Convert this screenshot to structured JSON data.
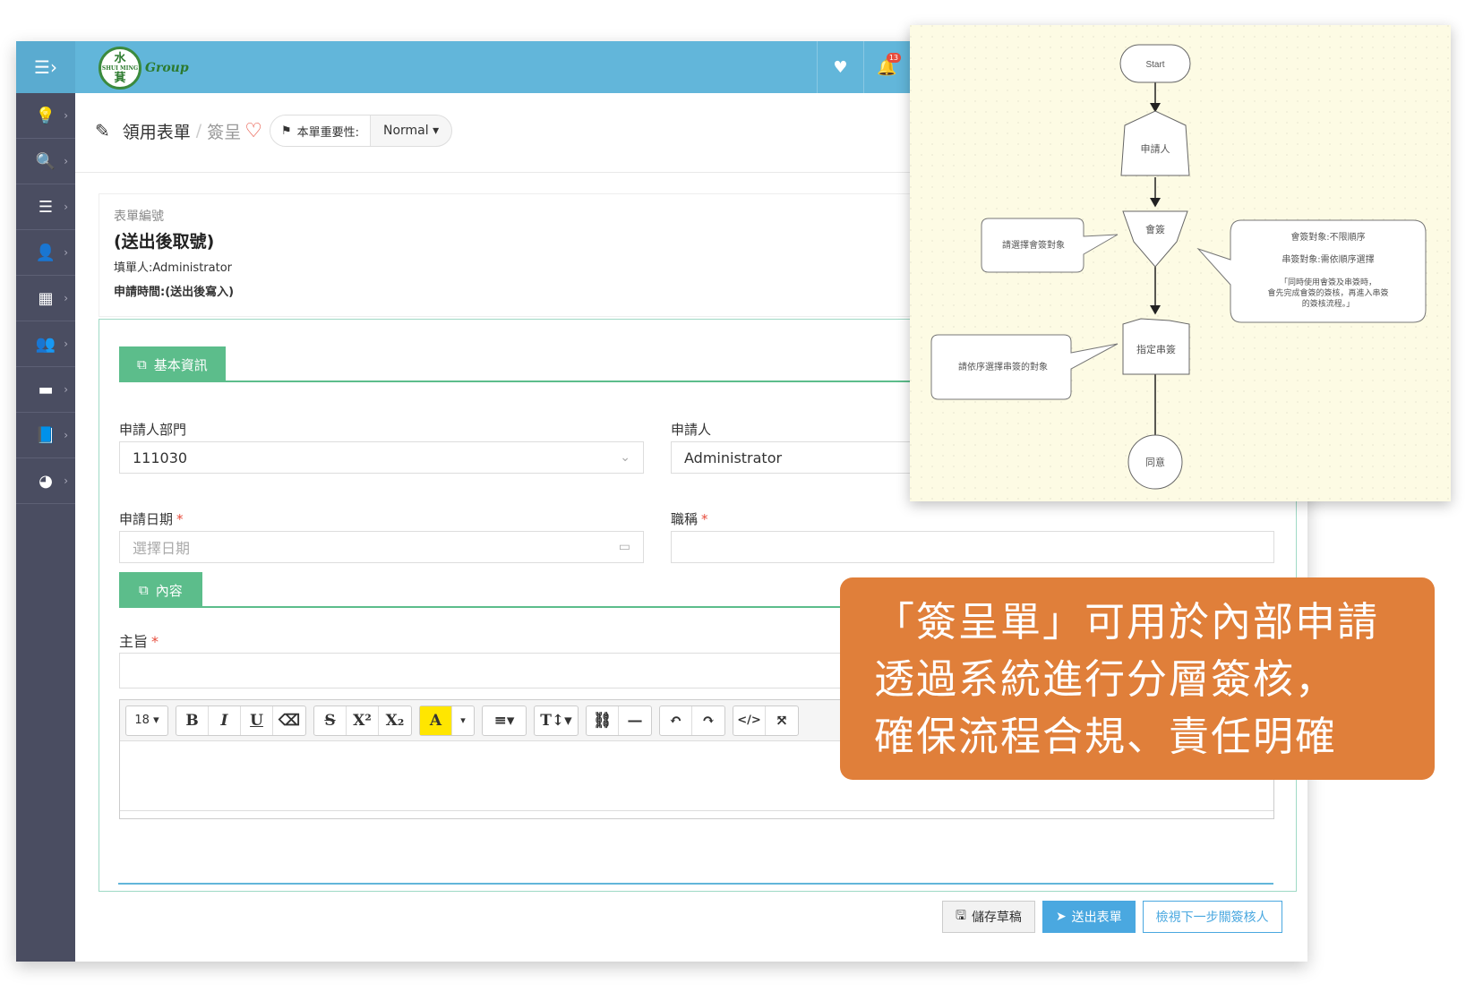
{
  "topbar": {
    "logo_char_top": "水",
    "logo_char_mid": "SHUI MING",
    "logo_char_bottom": "萁",
    "logo_text": "Group",
    "badge_count": "13"
  },
  "sidebar": {
    "items": [
      {
        "icon": "lightbulb-icon",
        "glyph": "💡"
      },
      {
        "icon": "search-icon",
        "glyph": "🔍"
      },
      {
        "icon": "server-icon",
        "glyph": "☰"
      },
      {
        "icon": "user-icon",
        "glyph": "👤"
      },
      {
        "icon": "building-icon",
        "glyph": "▦"
      },
      {
        "icon": "users-icon",
        "glyph": "👥"
      },
      {
        "icon": "archive-icon",
        "glyph": "▬"
      },
      {
        "icon": "book-icon",
        "glyph": "📘"
      },
      {
        "icon": "dashboard-icon",
        "glyph": "◕"
      }
    ]
  },
  "breadcrumb": {
    "form_type": "領用表單",
    "separator": "/",
    "current": "簽呈",
    "priority_label": "本單重要性:",
    "priority_value": "Normal"
  },
  "meta": {
    "form_no_label": "表單編號",
    "form_no_value": "(送出後取號)",
    "filler": "填單人:Administrator",
    "apply_time": "申請時間:(送出後寫入)"
  },
  "sections": {
    "basic": "基本資訊",
    "content": "內容"
  },
  "fields": {
    "dept_label": "申請人部門",
    "dept_value": "111030",
    "applicant_label": "申請人",
    "applicant_value": "Administrator",
    "date_label": "申請日期",
    "date_placeholder": "選擇日期",
    "title_label": "職稱",
    "subject_label": "主旨",
    "required_mark": "*"
  },
  "editor": {
    "font_size": "18"
  },
  "actions": {
    "save": "儲存草稿",
    "send": "送出表單",
    "next": "檢視下一步關簽核人"
  },
  "flow": {
    "start": "Start",
    "applicant": "申請人",
    "countersign": "會簽",
    "countersign_note": "請選擇會簽對象",
    "serial": "指定串簽",
    "serial_note": "請依序選擇串簽的對象",
    "end": "同意",
    "callout_line1": "會簽對象:不限順序",
    "callout_line2": "串簽對象:需依順序選擇",
    "callout_line3": "「同時使用會簽及串簽時，",
    "callout_line4": "會先完成會簽的簽核，再進入串簽",
    "callout_line5": "的簽核流程。」"
  },
  "callout": {
    "line1": "「簽呈單」可用於內部申請",
    "line2": "透過系統進行分層簽核，",
    "line3": "確保流程合規、責任明確"
  }
}
